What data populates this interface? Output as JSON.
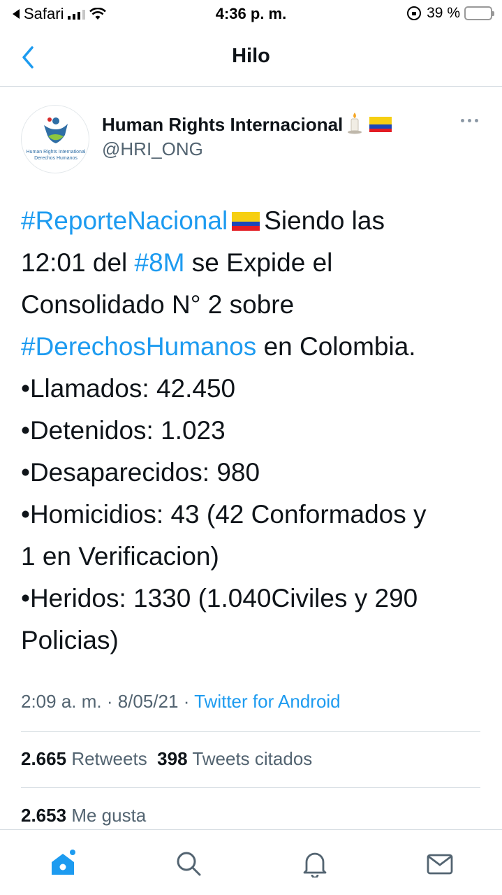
{
  "status_bar": {
    "back_app": "Safari",
    "time": "4:36 p. m.",
    "battery_percent": "39 %",
    "battery_level": 0.39
  },
  "nav": {
    "title": "Hilo"
  },
  "tweet": {
    "author_name": "Human Rights Internacional",
    "author_handle": "@HRI_ONG",
    "avatar_text_line1": "Human Rights International",
    "avatar_text_line2": "Derechos Humanos",
    "lines": {
      "l1_tag": "#ReporteNacional",
      "l1_rest": "Siendo las",
      "l2_a": "12:01 del ",
      "l2_tag": "#8M",
      "l2_b": " se Expide el",
      "l3": "Consolidado N° 2 sobre",
      "l4_tag": "#DerechosHumanos",
      "l4_rest": " en Colombia.",
      "l5": "•Llamados: 42.450",
      "l6": "•Detenidos: 1.023",
      "l7": "•Desaparecidos: 980",
      "l8": "•Homicidios: 43 (42 Conformados y",
      "l9": "1 en Verificacion)",
      "l10": "•Heridos: 1330 (1.040Civiles y 290",
      "l11": "Policias)"
    },
    "timestamp": "2:09 a. m. · 8/05/21 · ",
    "source": "Twitter for Android"
  },
  "stats": {
    "retweets_count": "2.665",
    "retweets_label": "Retweets",
    "quotes_count": "398",
    "quotes_label": "Tweets citados",
    "likes_count": "2.653",
    "likes_label": "Me gusta"
  },
  "tabbar": {
    "items": [
      "home-icon",
      "search-icon",
      "notifications-icon",
      "messages-icon"
    ],
    "accent": "#1d9bf0"
  }
}
